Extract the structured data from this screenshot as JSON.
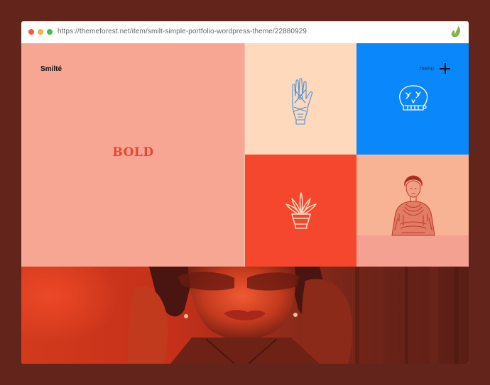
{
  "browser": {
    "url": "https://themeforest.net/item/smilt-simple-portfolio-wordpress-theme/22880929"
  },
  "site": {
    "logo": "Smilté",
    "menu_label": "menu",
    "headline": "BOLD"
  },
  "colors": {
    "background": "#62241b",
    "tile_pink": "#f6a693",
    "tile_cream": "#fed9bb",
    "tile_blue": "#0a87fb",
    "tile_orange": "#f5472d",
    "tile_peach": "#f8b294",
    "headline_red": "#e9472f",
    "envato_green": "#82b541"
  },
  "icons": [
    "hand-illustration-icon",
    "skull-illustration-icon",
    "plant-pot-illustration-icon",
    "woman-engraving-illustration",
    "plus-icon",
    "envato-leaf-icon"
  ]
}
